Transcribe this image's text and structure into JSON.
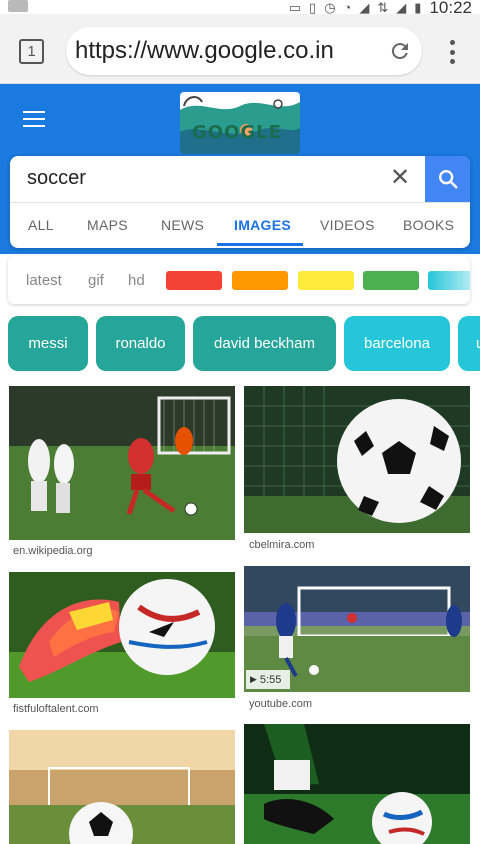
{
  "status_bar": {
    "time": "10:22",
    "icons": [
      "cast-icon",
      "vibrate-icon",
      "alarm-icon",
      "volte-icon",
      "signal-icon",
      "4g-icon",
      "signal-icon",
      "battery-icon"
    ]
  },
  "browser": {
    "tab_count": "1",
    "url": "https://www.google.co.in"
  },
  "header": {
    "doodle_text": "GOOGLE"
  },
  "search": {
    "query": "soccer",
    "tabs": [
      {
        "label": "ALL"
      },
      {
        "label": "MAPS"
      },
      {
        "label": "NEWS"
      },
      {
        "label": "IMAGES"
      },
      {
        "label": "VIDEOS"
      },
      {
        "label": "BOOKS"
      }
    ],
    "active_tab": "IMAGES"
  },
  "filters": {
    "words": [
      "latest",
      "gif",
      "hd"
    ],
    "colors": [
      "#f44336",
      "#ff9800",
      "#ffeb3b",
      "#4caf50",
      "#26c6da"
    ]
  },
  "chips": [
    {
      "label": "messi",
      "color": "#26a69a"
    },
    {
      "label": "ronaldo",
      "color": "#26a69a"
    },
    {
      "label": "david beckham",
      "color": "#26a69a"
    },
    {
      "label": "barcelona",
      "color": "#26c6da"
    },
    {
      "label": "u",
      "color": "#26c6da"
    }
  ],
  "results": [
    {
      "source": "en.wikipedia.org"
    },
    {
      "source": "cbelmira.com"
    },
    {
      "source": "fistfuloftalent.com"
    },
    {
      "source": "youtube.com",
      "duration": "5:55"
    },
    {
      "source": ""
    },
    {
      "source": ""
    }
  ]
}
